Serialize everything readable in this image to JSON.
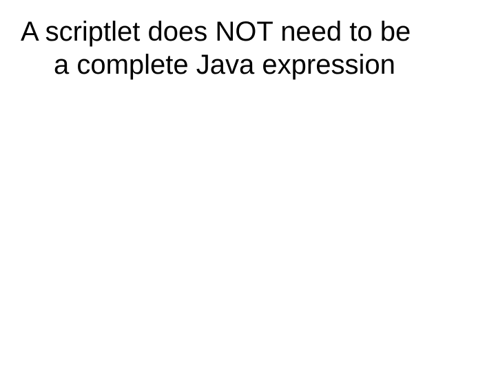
{
  "slide": {
    "title_line1": "A scriptlet does NOT need to be",
    "title_line2": "a complete Java expression"
  }
}
